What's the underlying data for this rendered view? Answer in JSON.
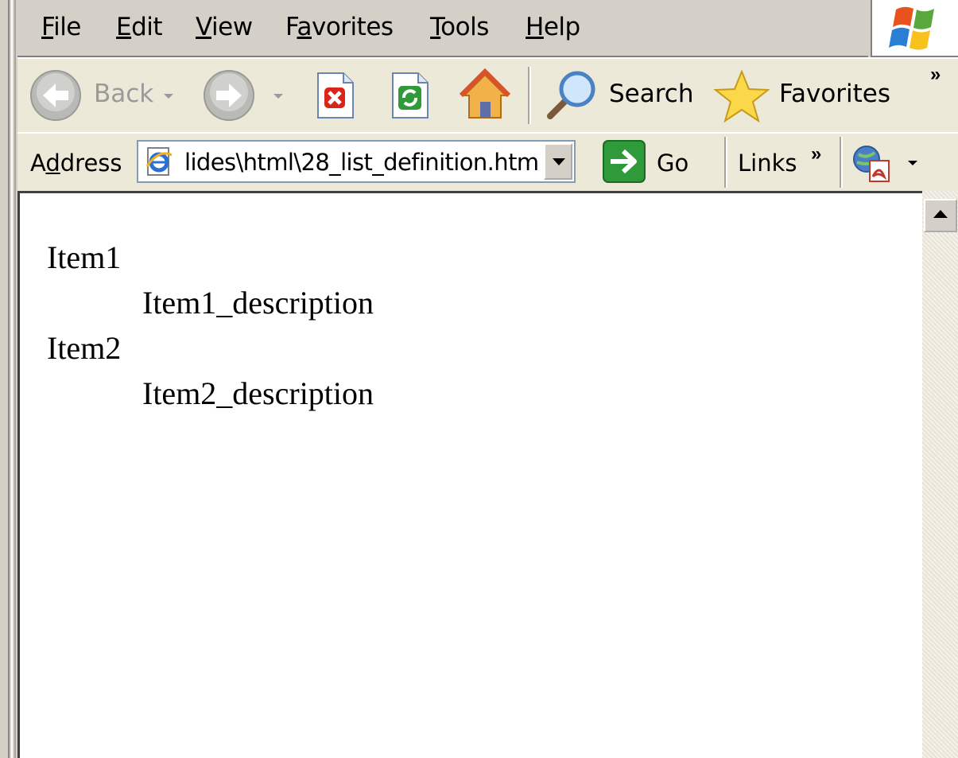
{
  "menu": {
    "file": {
      "key": "F",
      "rest": "ile"
    },
    "edit": {
      "key": "E",
      "rest": "dit"
    },
    "view": {
      "key": "V",
      "rest": "iew"
    },
    "favorites": {
      "pre": "F",
      "key": "a",
      "rest": "vorites"
    },
    "tools": {
      "key": "T",
      "rest": "ools"
    },
    "help": {
      "key": "H",
      "rest": "elp"
    }
  },
  "toolbar": {
    "back_label": "Back",
    "search_label": "Search",
    "favorites_label": "Favorites",
    "overflow": "»"
  },
  "address": {
    "label_pre": "A",
    "label_key": "d",
    "label_rest": "dress",
    "value": "lides\\html\\28_list_definition.htm",
    "go_label": "Go",
    "links_label": "Links",
    "links_overflow": "»"
  },
  "content": {
    "items": [
      {
        "term": "Item1",
        "description": "Item1_description"
      },
      {
        "term": "Item2",
        "description": "Item2_description"
      }
    ]
  },
  "colors": {
    "chrome": "#d4d0c8",
    "toolbar": "#ece9d8",
    "page": "#ffffff",
    "address_border": "#7f9db9"
  }
}
